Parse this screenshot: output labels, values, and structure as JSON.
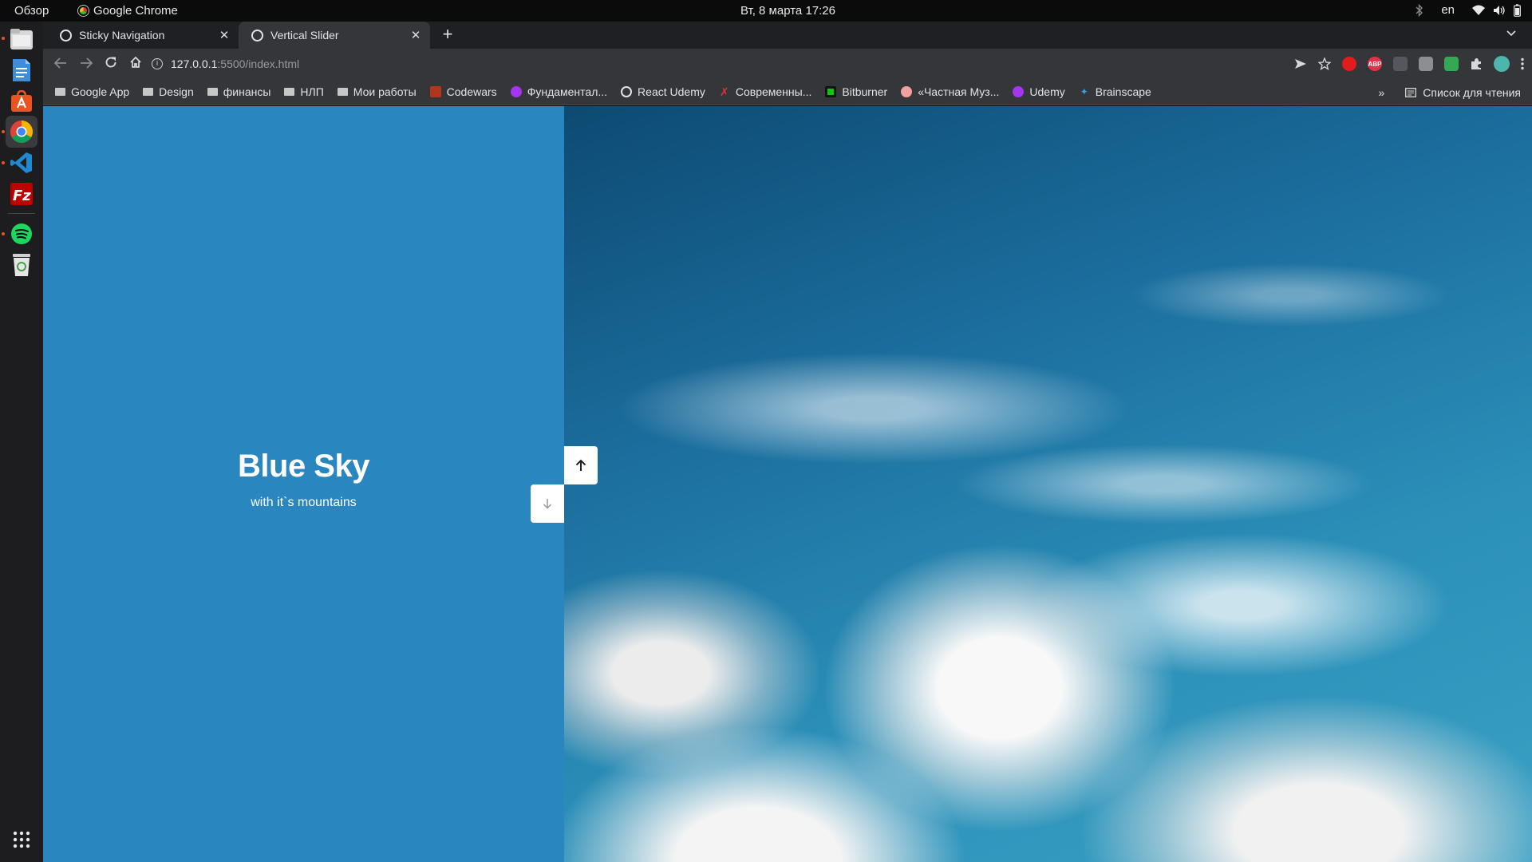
{
  "topbar": {
    "activities": "Обзор",
    "app_name": "Google Chrome",
    "clock": "Вт, 8 марта  17:26",
    "lang": "en"
  },
  "dock": {
    "items": [
      "files-icon",
      "writer-icon",
      "software-icon",
      "chrome-icon",
      "vscode-icon",
      "filezilla-icon",
      "spotify-icon",
      "trash-icon",
      "app-grid-icon"
    ]
  },
  "tabs": [
    {
      "title": "Sticky Navigation",
      "close": "✕"
    },
    {
      "title": "Vertical Slider",
      "close": "✕"
    }
  ],
  "toolbar": {
    "url_host": "127.0.0.1",
    "url_path": ":5500/index.html"
  },
  "bookmarks": {
    "items": [
      {
        "label": "Google App",
        "type": "folder"
      },
      {
        "label": "Design",
        "type": "folder"
      },
      {
        "label": "финансы",
        "type": "folder"
      },
      {
        "label": "НЛП",
        "type": "folder"
      },
      {
        "label": "Мои работы",
        "type": "folder"
      },
      {
        "label": "Codewars",
        "type": "site",
        "color": "#b1361e"
      },
      {
        "label": "Фундаментал...",
        "type": "site",
        "color": "#a435f0"
      },
      {
        "label": "React Udemy",
        "type": "site",
        "color": "#e3e3e3"
      },
      {
        "label": "Современны...",
        "type": "site",
        "color": "#d33"
      },
      {
        "label": "Bitburner",
        "type": "site",
        "color": "#0c0"
      },
      {
        "label": "«Частная Муз...",
        "type": "site",
        "color": "#f2a0a0"
      },
      {
        "label": "Udemy",
        "type": "site",
        "color": "#a435f0"
      },
      {
        "label": "Brainscape",
        "type": "site",
        "color": "#3aa0e8"
      }
    ],
    "overflow": "»",
    "reading_list": "Список для чтения"
  },
  "page": {
    "title": "Blue Sky",
    "subtitle": "with it`s mountains",
    "left_color": "#2a86bf"
  }
}
